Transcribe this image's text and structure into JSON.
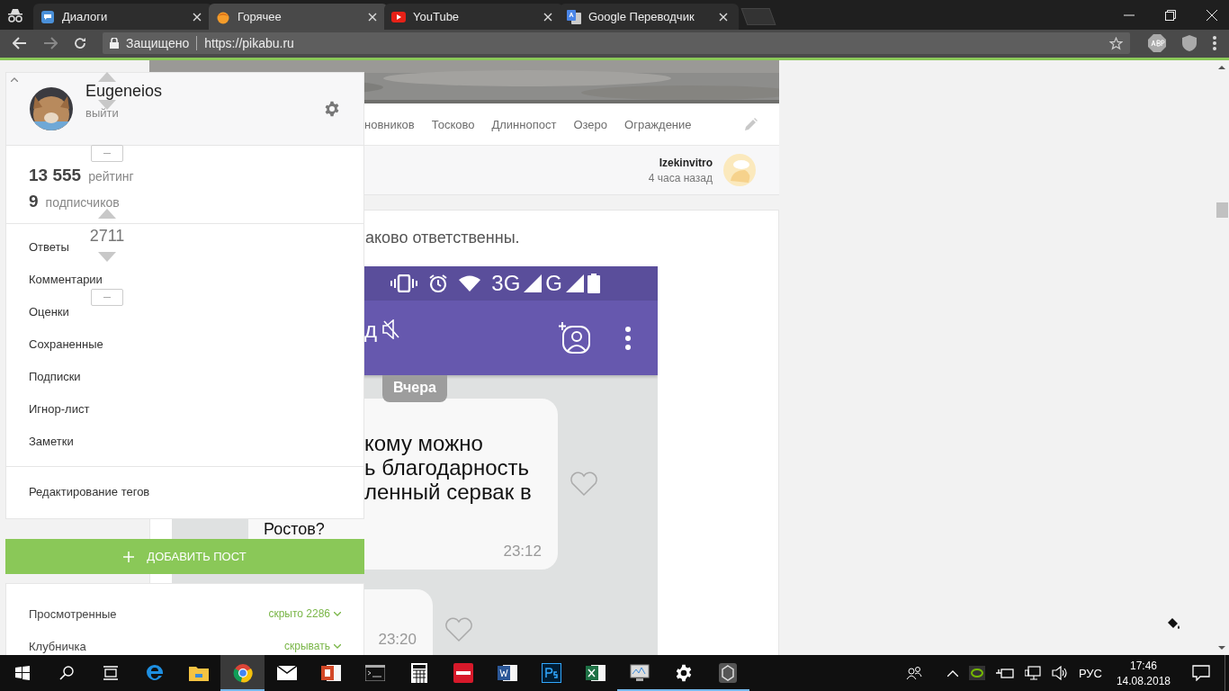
{
  "browser": {
    "tabs": [
      {
        "title": "Диалоги",
        "kind": "chat",
        "selected": false
      },
      {
        "title": "Горячее",
        "kind": "pikabu",
        "selected": true
      },
      {
        "title": "YouTube",
        "kind": "youtube",
        "selected": false
      },
      {
        "title": "Google Переводчик",
        "kind": "translate",
        "selected": false
      }
    ],
    "address": {
      "security": "Защищено",
      "url": "https://pikabu.ru"
    }
  },
  "feed": {
    "prev_post": {
      "tags": [
        "новников",
        "Тосково",
        "Длиннопост",
        "Озеро",
        "Ограждение"
      ],
      "author": {
        "name": "Izekinvitro",
        "time": "4 часа назад"
      }
    },
    "votes": [
      {
        "kind": "covered"
      },
      {
        "kind": "open",
        "rating": "2711"
      }
    ],
    "post": {
      "text": "аково ответственны.",
      "screenshot": {
        "networks": [
          "3G",
          "G"
        ],
        "chat_title": "д",
        "date_chip": "Вчера",
        "messages": [
          {
            "lines": [
              "кому можно",
              "ь благодарность",
              "ленный сервак в",
              "Ростов?"
            ],
            "time": "23:12"
          },
          {
            "time": "23:20"
          }
        ]
      }
    }
  },
  "sidebar": {
    "user": {
      "name": "Eugeneios",
      "logout": "выйти"
    },
    "stats": [
      {
        "value": "13 555",
        "label": "рейтинг"
      },
      {
        "value": "9",
        "label": "подписчиков"
      }
    ],
    "menu": [
      "Ответы",
      "Комментарии",
      "Оценки",
      "Сохраненные",
      "Подписки",
      "Игнор-лист",
      "Заметки"
    ],
    "tags_link": "Редактирование тегов",
    "add_post": "ДОБАВИТЬ ПОСТ",
    "filters": [
      {
        "label": "Просмотренные",
        "action": "скрыто 2286"
      },
      {
        "label": "Клубничка",
        "action": "скрывать"
      }
    ]
  },
  "taskbar": {
    "buttons": [
      {
        "kind": "start",
        "running": false,
        "selected": false
      },
      {
        "kind": "search",
        "running": false,
        "selected": false
      },
      {
        "kind": "taskview",
        "running": false,
        "selected": false
      },
      {
        "kind": "edge",
        "running": false,
        "selected": false
      },
      {
        "kind": "explorer",
        "running": false,
        "selected": false
      },
      {
        "kind": "chrome",
        "running": true,
        "selected": true
      },
      {
        "kind": "mail",
        "running": false,
        "selected": false
      },
      {
        "kind": "powerpoint",
        "running": false,
        "selected": false
      },
      {
        "kind": "terminal",
        "running": false,
        "selected": false
      },
      {
        "kind": "calculator",
        "running": false,
        "selected": false
      },
      {
        "kind": "nero",
        "running": false,
        "selected": false
      },
      {
        "kind": "word",
        "running": false,
        "selected": false
      },
      {
        "kind": "photoshop",
        "running": false,
        "selected": false
      },
      {
        "kind": "excel",
        "running": false,
        "selected": false
      },
      {
        "kind": "monitor",
        "running": true,
        "selected": false
      },
      {
        "kind": "settings",
        "running": true,
        "selected": false
      },
      {
        "kind": "game",
        "running": true,
        "selected": false
      }
    ],
    "tray": {
      "language": "РУС",
      "time": "17:46",
      "date": "14.08.2018"
    }
  }
}
